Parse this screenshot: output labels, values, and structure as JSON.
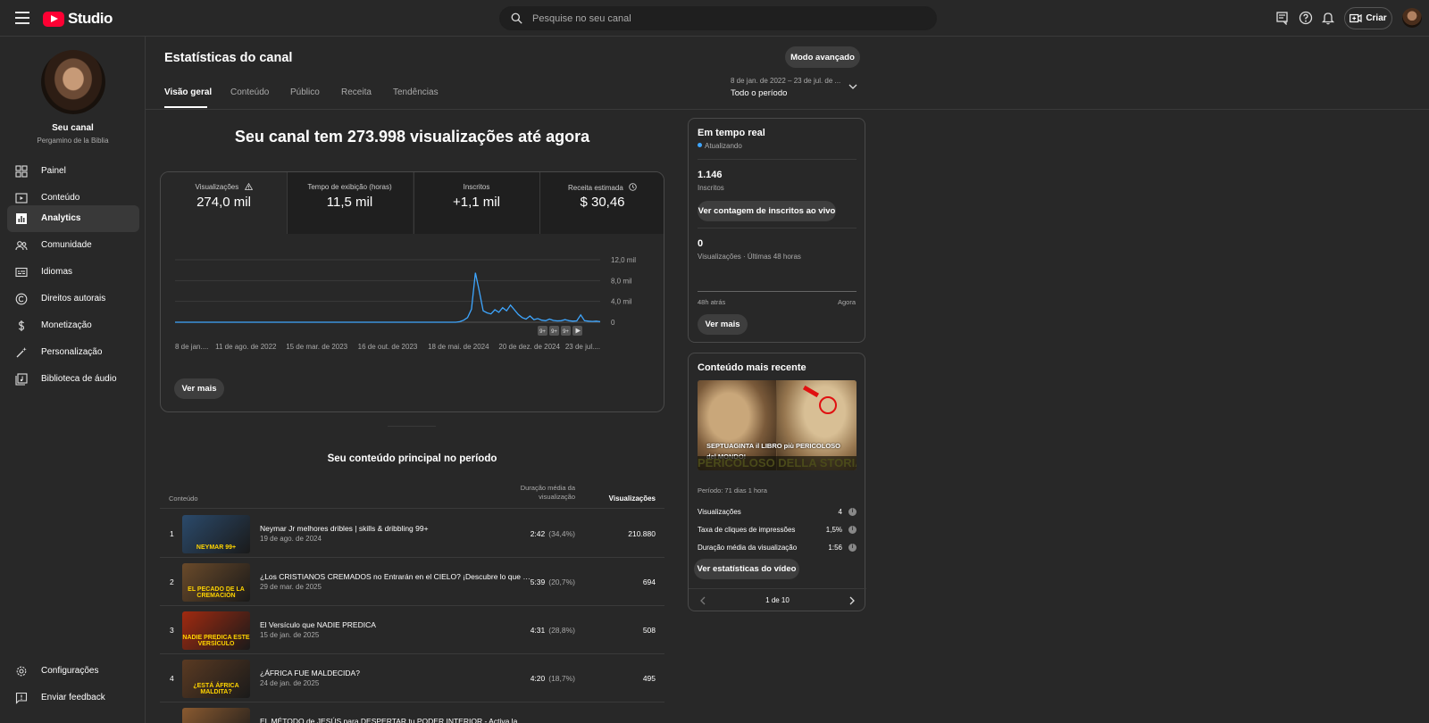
{
  "app": {
    "logo_text": "Studio",
    "brand_color": "#ff0033",
    "accent_color": "#3ea6ff"
  },
  "search": {
    "placeholder": "Pesquise no seu canal"
  },
  "topbar": {
    "create_label": "Criar"
  },
  "sidebar": {
    "channel_name": "Seu canal",
    "channel_handle": "Pergamino de la Biblia",
    "items": [
      {
        "label": "Painel",
        "icon": "dashboard-icon"
      },
      {
        "label": "Conteúdo",
        "icon": "content-icon"
      },
      {
        "label": "Analytics",
        "icon": "analytics-icon",
        "active": true
      },
      {
        "label": "Comunidade",
        "icon": "community-icon"
      },
      {
        "label": "Idiomas",
        "icon": "subtitles-icon"
      },
      {
        "label": "Direitos autorais",
        "icon": "copyright-icon"
      },
      {
        "label": "Monetização",
        "icon": "dollar-icon"
      },
      {
        "label": "Personalização",
        "icon": "magic-wand-icon"
      },
      {
        "label": "Biblioteca de áudio",
        "icon": "audio-library-icon"
      }
    ],
    "bottom_items": [
      {
        "label": "Configurações",
        "icon": "gear-icon"
      },
      {
        "label": "Enviar feedback",
        "icon": "feedback-icon"
      }
    ]
  },
  "page": {
    "title": "Estatísticas do canal",
    "advanced_mode": "Modo avançado",
    "tabs": [
      "Visão geral",
      "Conteúdo",
      "Público",
      "Receita",
      "Tendências"
    ],
    "active_tab": 0,
    "period_range": "8 de jan. de 2022 – 23 de jul. de ...",
    "period_label": "Todo o período",
    "headline": "Seu canal tem 273.998 visualizações até agora"
  },
  "metrics": [
    {
      "label": "Visualizações",
      "value": "274,0 mil",
      "icon": "warning-icon",
      "active": true
    },
    {
      "label": "Tempo de exibição (horas)",
      "value": "11,5 mil"
    },
    {
      "label": "Inscritos",
      "value": "+1,1 mil"
    },
    {
      "label": "Receita estimada",
      "value": "$ 30,46",
      "icon": "clock-icon"
    }
  ],
  "chart_data": {
    "type": "line",
    "series": [
      {
        "values": [
          0,
          0,
          0,
          0,
          0,
          0,
          0,
          0,
          0,
          0,
          0,
          0,
          0,
          0,
          0,
          0,
          0,
          0,
          0,
          0,
          0,
          0,
          0,
          0,
          0,
          0,
          0,
          0,
          0,
          0,
          0,
          0,
          0,
          0,
          0,
          0,
          0,
          0,
          0,
          0,
          0,
          0,
          0,
          0,
          0,
          0,
          0,
          0,
          0,
          0,
          0,
          0,
          0,
          0,
          0,
          0,
          0,
          0,
          0,
          0,
          0,
          0,
          0,
          0,
          0,
          0,
          0,
          0,
          0,
          0,
          0,
          0,
          0,
          100,
          400,
          900,
          2500,
          9500,
          6000,
          2200,
          1800,
          1600,
          2400,
          1900,
          2800,
          2200,
          3300,
          2400,
          1500,
          900,
          600,
          1200,
          500,
          700,
          400,
          300,
          600,
          350,
          250,
          300,
          500,
          300,
          200,
          250,
          1400,
          300,
          200,
          150,
          200,
          100
        ]
      }
    ],
    "x_labels": [
      "8 de jan....",
      "11 de ago. de 2022",
      "15 de mar. de 2023",
      "16 de out. de 2023",
      "18 de mai. de 2024",
      "20 de dez. de 2024",
      "23 de jul...."
    ],
    "y_ticks": [
      "12,0 mil",
      "8,0 mil",
      "4,0 mil",
      "0"
    ],
    "ylim": [
      0,
      12000
    ],
    "series_color": "#3ea6ff",
    "grid": true,
    "legend": "none"
  },
  "chart_controls": [
    "9+",
    "9+",
    "9+"
  ],
  "overview": {
    "see_more": "Ver mais"
  },
  "top_content": {
    "title": "Seu conteúdo principal no período",
    "col_content": "Conteúdo",
    "col_duration": "Duração média da visualização",
    "col_views": "Visualizações",
    "rows": [
      {
        "rank": "1",
        "title": "Neymar Jr melhores dribles | skills & dribbling 99+",
        "date": "19 de ago. de 2024",
        "duration": "2:42",
        "pct": "(34,4%)",
        "views": "210.880",
        "thumb_text": "NEYMAR 99+",
        "thumb_color": "#2b4a6b"
      },
      {
        "rank": "2",
        "title": "¿Los CRISTIANOS CREMADOS no Entrarán en el CIELO? ¡Descubre lo que dice la ...",
        "date": "29 de mar. de 2025",
        "duration": "5:39",
        "pct": "(20,7%)",
        "views": "694",
        "thumb_text": "EL PECADO DE LA CREMACIÓN",
        "thumb_color": "#6a4a2a"
      },
      {
        "rank": "3",
        "title": "El Versículo que NADIE PREDICA",
        "date": "15 de jan. de 2025",
        "duration": "4:31",
        "pct": "(28,8%)",
        "views": "508",
        "thumb_text": "NADIE PREDICA ESTE VERSÍCULO",
        "thumb_color": "#a02a10"
      },
      {
        "rank": "4",
        "title": "¿ÁFRICA FUE MALDECIDA?",
        "date": "24 de jan. de 2025",
        "duration": "4:20",
        "pct": "(18,7%)",
        "views": "495",
        "thumb_text": "¿ESTÁ ÁFRICA MALDITA?",
        "thumb_color": "#5a3a22"
      },
      {
        "rank": "5",
        "title": "EL MÉTODO de JESÚS para DESPERTAR tu PODER INTERIOR - Activa la GLÁNDU...",
        "date": "",
        "duration": "",
        "pct": "",
        "views": "",
        "thumb_text": "",
        "thumb_color": "#8a5a30"
      }
    ]
  },
  "realtime": {
    "title": "Em tempo real",
    "status": "Atualizando",
    "subscribers_value": "1.146",
    "subscribers_label": "Inscritos",
    "live_count_button": "Ver contagem de inscritos ao vivo",
    "views_value": "0",
    "views_label": "Visualizações · Últimas 48 horas",
    "axis_left": "48h atrás",
    "axis_right": "Agora",
    "see_more": "Ver mais"
  },
  "recent": {
    "title": "Conteúdo mais recente",
    "thumb_caption": "SEPTUAGINTA il LIBRO più PERICOLOSO del MONDO!",
    "thumb_banner": "PERICOLOSO DELLA STORIA",
    "period": "Período: 71 dias 1 hora",
    "stats": [
      {
        "label": "Visualizações",
        "value": "4"
      },
      {
        "label": "Taxa de cliques de impressões",
        "value": "1,5%"
      },
      {
        "label": "Duração média da visualização",
        "value": "1:56"
      }
    ],
    "video_stats_button": "Ver estatísticas do vídeo",
    "pager": "1 de 10"
  }
}
